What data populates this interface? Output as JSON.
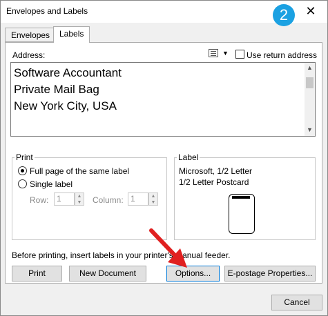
{
  "window": {
    "title": "Envelopes and Labels",
    "close_glyph": "✕",
    "step_badge": "2"
  },
  "tabs": [
    {
      "label": "Envelopes",
      "active": false
    },
    {
      "label": "Labels",
      "active": true
    }
  ],
  "address": {
    "label": "Address:",
    "use_return_label": "Use return address",
    "use_return_checked": false,
    "lines": [
      "Software Accountant",
      "Private Mail Bag",
      "New York City, USA"
    ]
  },
  "print": {
    "group_label": "Print",
    "full_page_label": "Full page of the same label",
    "single_label_label": "Single label",
    "row_label": "Row:",
    "row_value": "1",
    "column_label": "Column:",
    "column_value": "1",
    "selected": "full_page"
  },
  "label": {
    "group_label": "Label",
    "line1": "Microsoft, 1/2 Letter",
    "line2": "1/2 Letter Postcard"
  },
  "info_text": "Before printing, insert labels in your printer's manual feeder.",
  "buttons": {
    "print": "Print",
    "new_document": "New Document",
    "options": "Options...",
    "epostage": "E-postage Properties...",
    "cancel": "Cancel"
  },
  "colors": {
    "badge": "#1ba1e2",
    "arrow": "#e02020",
    "focus": "#0078d7"
  }
}
